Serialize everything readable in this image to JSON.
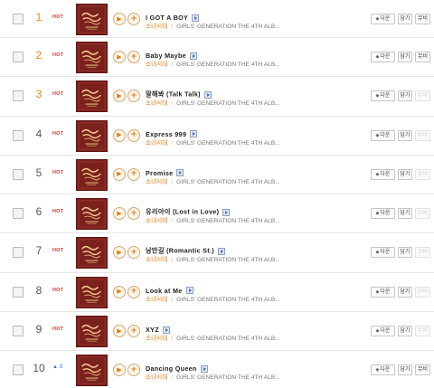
{
  "songs": [
    {
      "rank": "1",
      "status": "HOT",
      "title": "I GOT A BOY",
      "artist": "소녀시대",
      "album": "GIRLS' GENERATION THE 4TH ALB..."
    },
    {
      "rank": "2",
      "status": "HOT",
      "title": "Baby Maybe",
      "artist": "소녀시대",
      "album": "GIRLS' GENERATION THE 4TH ALB..."
    },
    {
      "rank": "3",
      "status": "HOT",
      "title": "말해봐 (Talk Talk)",
      "artist": "소녀시대",
      "album": "GIRLS' GENERATION THE 4TH ALB..."
    },
    {
      "rank": "4",
      "status": "HOT",
      "title": "Express 999",
      "artist": "소녀시대",
      "album": "GIRLS' GENERATION THE 4TH ALB..."
    },
    {
      "rank": "5",
      "status": "HOT",
      "title": "Promise",
      "artist": "소녀시대",
      "album": "GIRLS' GENERATION THE 4TH ALB..."
    },
    {
      "rank": "6",
      "status": "HOT",
      "title": "유리아이 (Lost in Love)",
      "artist": "소녀시대",
      "album": "GIRLS' GENERATION THE 4TH ALB..."
    },
    {
      "rank": "7",
      "status": "HOT",
      "title": "낭만길 (Romantic St.)",
      "artist": "소녀시대",
      "album": "GIRLS' GENERATION THE 4TH ALB..."
    },
    {
      "rank": "8",
      "status": "HOT",
      "title": "Look at Me",
      "artist": "소녀시대",
      "album": "GIRLS' GENERATION THE 4TH ALB..."
    },
    {
      "rank": "9",
      "status": "HOT",
      "title": "XYZ",
      "artist": "소녀시대",
      "album": "GIRLS' GENERATION THE 4TH ALB..."
    },
    {
      "rank": "10",
      "status": "▲ 8",
      "title": "Dancing Queen",
      "artist": "소녀시대",
      "album": "GIRLS' GENERATION THE 4TH ALB..."
    }
  ],
  "mv_available": [
    true,
    true,
    false,
    false,
    false,
    false,
    false,
    false,
    false,
    true
  ],
  "labels": {
    "download": "다운",
    "put": "담기",
    "mv": "뮤비",
    "separator": "/"
  },
  "colors": {
    "rank_top": "#e8891d",
    "hot": "#d8382c",
    "up": "#3d79c9",
    "artist": "#e07a14"
  }
}
